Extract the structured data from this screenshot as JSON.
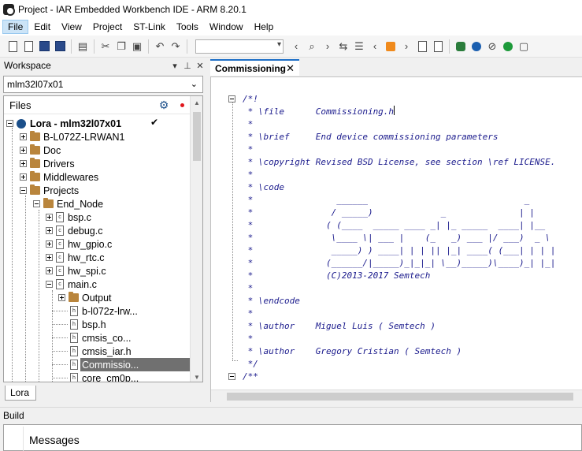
{
  "window": {
    "title": "Project - IAR Embedded Workbench IDE - ARM 8.20.1"
  },
  "menu": {
    "items": [
      "File",
      "Edit",
      "View",
      "Project",
      "ST-Link",
      "Tools",
      "Window",
      "Help"
    ],
    "active": "File"
  },
  "workspace": {
    "title": "Workspace",
    "config": "mlm32l07x01",
    "files_header": "Files",
    "project": "Lora - mlm32l07x01",
    "bottom_tab": "Lora",
    "tree": [
      {
        "label": "B-L072Z-LRWAN1",
        "type": "folder"
      },
      {
        "label": "Doc",
        "type": "folder"
      },
      {
        "label": "Drivers",
        "type": "folder"
      },
      {
        "label": "Middlewares",
        "type": "folder"
      },
      {
        "label": "Projects",
        "type": "folder"
      },
      {
        "label": "End_Node",
        "type": "folder"
      },
      {
        "label": "bsp.c",
        "type": "c"
      },
      {
        "label": "debug.c",
        "type": "c"
      },
      {
        "label": "hw_gpio.c",
        "type": "c"
      },
      {
        "label": "hw_rtc.c",
        "type": "c"
      },
      {
        "label": "hw_spi.c",
        "type": "c"
      },
      {
        "label": "main.c",
        "type": "c"
      },
      {
        "label": "Output",
        "type": "folder"
      },
      {
        "label": "b-l072z-lrw...",
        "type": "h"
      },
      {
        "label": "bsp.h",
        "type": "h"
      },
      {
        "label": "cmsis_co...",
        "type": "h"
      },
      {
        "label": "cmsis_iar.h",
        "type": "h"
      },
      {
        "label": "Commissio...",
        "type": "h",
        "selected": true
      },
      {
        "label": "core_cm0p...",
        "type": "h"
      }
    ]
  },
  "editor": {
    "tab": "Commissioning",
    "lines": [
      "/*!",
      " * \\file      Commissioning.h",
      " *",
      " * \\brief     End device commissioning parameters",
      " *",
      " * \\copyright Revised BSD License, see section \\ref LICENSE.",
      " *",
      " * \\code",
      " *                ______                              _",
      " *               / _____)             _              | |",
      " *              ( (____  _____ ____ _| |_ _____  ____| |__",
      " *               \\____ \\| ___ |    (_   _) ___ |/ ___)  _ \\",
      " *               _____) ) ____| | | || |_| ____( (___| | | |",
      " *              (______/|_____)_|_|_| \\__)_____)\\____)_| |_|",
      " *              (C)2013-2017 Semtech",
      " *",
      " * \\endcode",
      " *",
      " * \\author    Miguel Luis ( Semtech )",
      " *",
      " * \\author    Gregory Cristian ( Semtech )",
      " */",
      "/**"
    ]
  },
  "build": {
    "title": "Build",
    "column": "Messages"
  }
}
